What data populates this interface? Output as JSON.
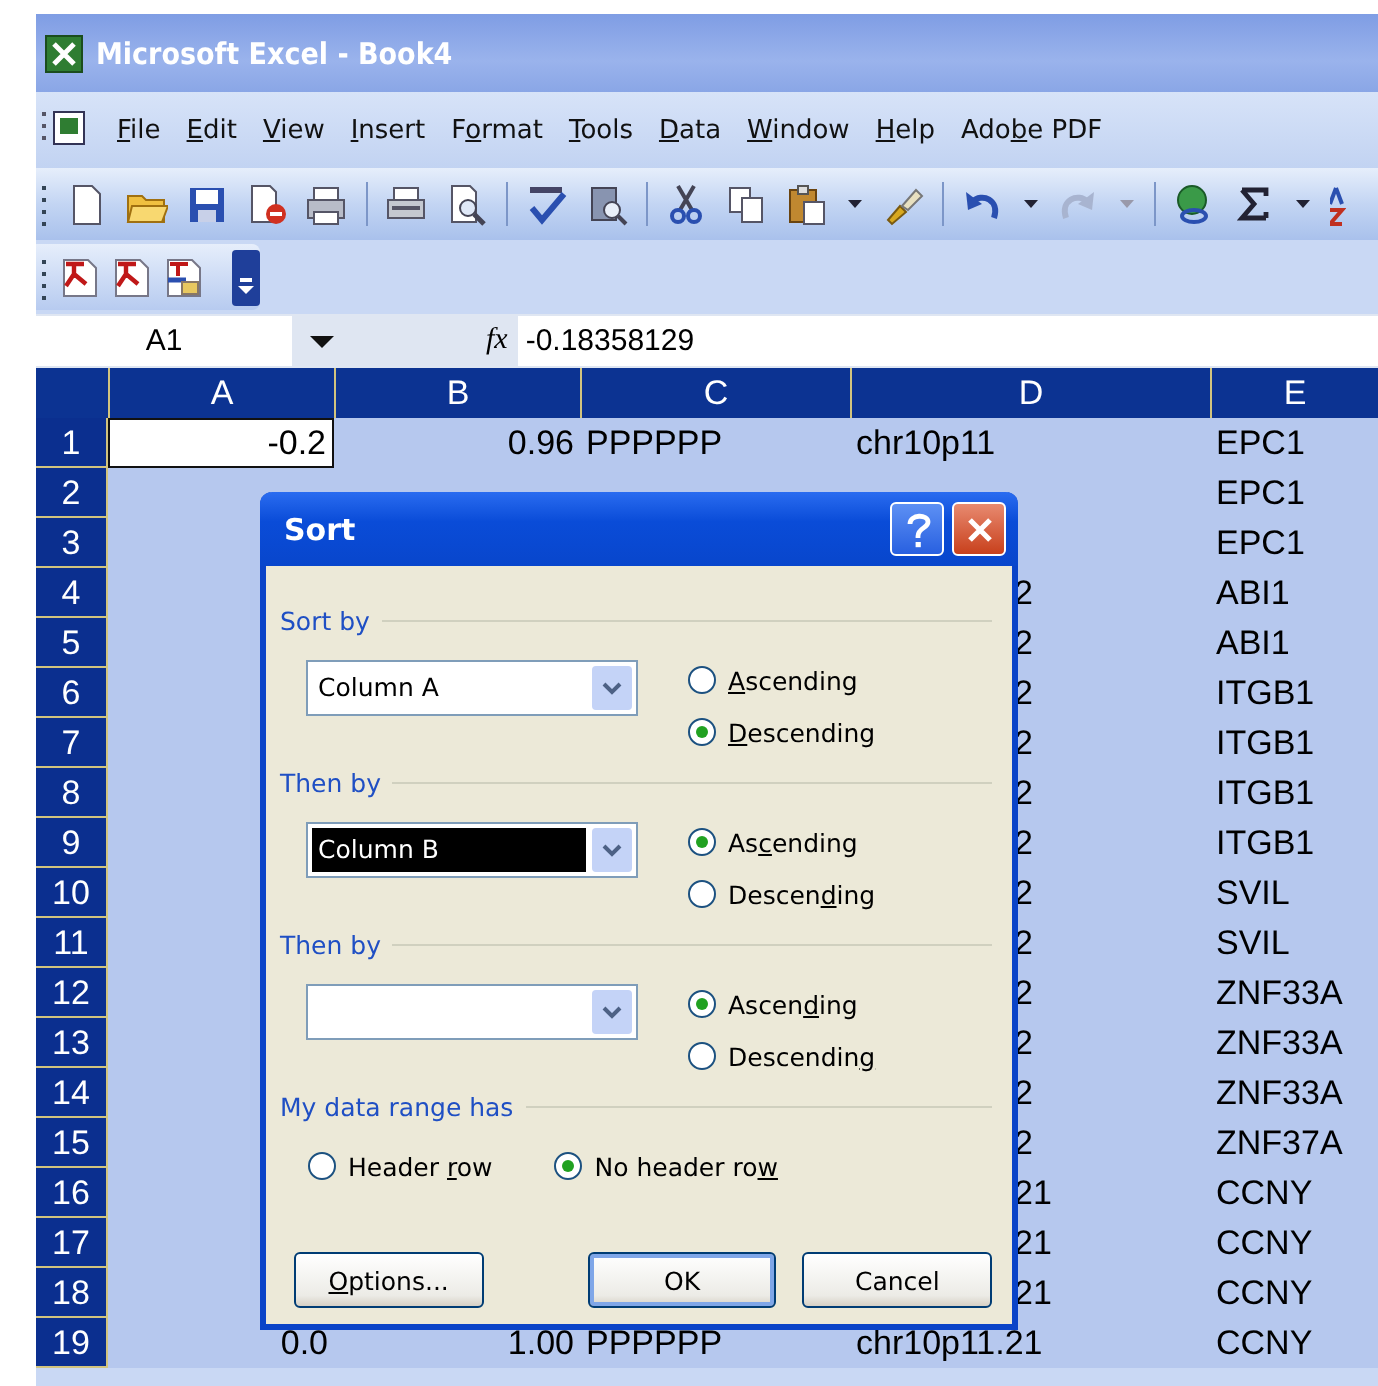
{
  "window": {
    "title": "Microsoft Excel - Book4"
  },
  "menu_bar": [
    {
      "key": "F",
      "after": "ile"
    },
    {
      "key": "E",
      "after": "dit"
    },
    {
      "key": "V",
      "after": "iew"
    },
    {
      "key": "I",
      "after": "nsert"
    },
    {
      "before": "F",
      "key": "o",
      "after": "rmat"
    },
    {
      "key": "T",
      "after": "ools"
    },
    {
      "key": "D",
      "after": "ata"
    },
    {
      "key": "W",
      "after": "indow"
    },
    {
      "key": "H",
      "after": "elp"
    },
    {
      "before": "Ado",
      "key": "b",
      "after": "e PDF"
    }
  ],
  "formula_bar": {
    "name_box": "A1",
    "fx": "fx",
    "formula": "-0.18358129"
  },
  "sheet": {
    "columns": [
      "A",
      "B",
      "C",
      "D",
      "E"
    ],
    "rows": [
      {
        "header": "1",
        "selected": true,
        "cursor": true,
        "covered": false,
        "cells": {
          "A": "-0.2",
          "B": "0.96",
          "C": "PPPPPP",
          "D": "chr10p11",
          "E": "EPC1"
        }
      },
      {
        "header": "2",
        "selected": true,
        "cursor": false,
        "covered": true,
        "cells": {
          "E": "EPC1"
        }
      },
      {
        "header": "3",
        "selected": true,
        "cursor": false,
        "covered": true,
        "cells": {
          "E": "EPC1"
        }
      },
      {
        "header": "4",
        "selected": true,
        "cursor": false,
        "covered": true,
        "cells": {
          "D": "2",
          "E": "ABI1"
        }
      },
      {
        "header": "5",
        "selected": true,
        "cursor": false,
        "covered": true,
        "cells": {
          "D": "2",
          "E": "ABI1"
        }
      },
      {
        "header": "6",
        "selected": true,
        "cursor": false,
        "covered": true,
        "cells": {
          "D": "2",
          "E": "ITGB1"
        }
      },
      {
        "header": "7",
        "selected": true,
        "cursor": false,
        "covered": true,
        "cells": {
          "D": "2",
          "E": "ITGB1"
        }
      },
      {
        "header": "8",
        "selected": true,
        "cursor": false,
        "covered": true,
        "cells": {
          "D": "2",
          "E": "ITGB1"
        }
      },
      {
        "header": "9",
        "selected": true,
        "cursor": false,
        "covered": true,
        "cells": {
          "D": "2",
          "E": "ITGB1"
        }
      },
      {
        "header": "10",
        "selected": true,
        "cursor": false,
        "covered": true,
        "cells": {
          "D": "2",
          "E": "SVIL"
        }
      },
      {
        "header": "11",
        "selected": true,
        "cursor": false,
        "covered": true,
        "cells": {
          "D": "2",
          "E": "SVIL"
        }
      },
      {
        "header": "12",
        "selected": true,
        "cursor": false,
        "covered": true,
        "cells": {
          "D": "2",
          "E": "ZNF33A"
        }
      },
      {
        "header": "13",
        "selected": true,
        "cursor": false,
        "covered": true,
        "cells": {
          "D": "2",
          "E": "ZNF33A"
        }
      },
      {
        "header": "14",
        "selected": true,
        "cursor": false,
        "covered": true,
        "cells": {
          "D": "2",
          "E": "ZNF33A"
        }
      },
      {
        "header": "15",
        "selected": true,
        "cursor": false,
        "covered": true,
        "cells": {
          "D": "2",
          "E": "ZNF37A"
        }
      },
      {
        "header": "16",
        "selected": true,
        "cursor": false,
        "covered": true,
        "cells": {
          "D": "21",
          "E": "CCNY"
        }
      },
      {
        "header": "17",
        "selected": true,
        "cursor": false,
        "covered": true,
        "cells": {
          "D": "21",
          "E": "CCNY"
        }
      },
      {
        "header": "18",
        "selected": true,
        "cursor": false,
        "covered": true,
        "cells": {
          "D": "21",
          "E": "CCNY"
        }
      },
      {
        "header": "19",
        "selected": true,
        "cursor": false,
        "covered": false,
        "cells": {
          "A": "0.0",
          "B": "1.00",
          "C": "PPPPPP",
          "D": "chr10p11.21",
          "E": "CCNY"
        }
      }
    ]
  },
  "dialog": {
    "title": "Sort",
    "sections": [
      {
        "label": "Sort by",
        "field": {
          "value": "Column A",
          "highlighted": false
        },
        "options": [
          {
            "key": "A",
            "after": "scending",
            "selected": false
          },
          {
            "key": "D",
            "after": "escending",
            "selected": true
          }
        ]
      },
      {
        "label": "Then by",
        "field": {
          "value": "Column B",
          "highlighted": true
        },
        "options": [
          {
            "before": "As",
            "key": "c",
            "after": "ending",
            "selected": true
          },
          {
            "before": "Descen",
            "key": "d",
            "after": "ing",
            "selected": false
          }
        ]
      },
      {
        "label": "Then by",
        "field": {
          "highlighted": false
        },
        "options": [
          {
            "before": "Ascen",
            "key": "d",
            "after": "ing",
            "selected": true
          },
          {
            "before": "Descendin",
            "key": "g",
            "selected": false
          }
        ]
      }
    ],
    "header_section": {
      "label": "My data range has",
      "options": [
        {
          "before": "Header ",
          "key": "r",
          "after": "ow",
          "selected": false
        },
        {
          "before": "No header ro",
          "key": "w",
          "selected": true
        }
      ]
    },
    "buttons": [
      {
        "key": "O",
        "after": "ptions...",
        "default": false
      },
      {
        "before": "OK",
        "default": true
      },
      {
        "before": "Cancel",
        "default": false
      }
    ]
  }
}
